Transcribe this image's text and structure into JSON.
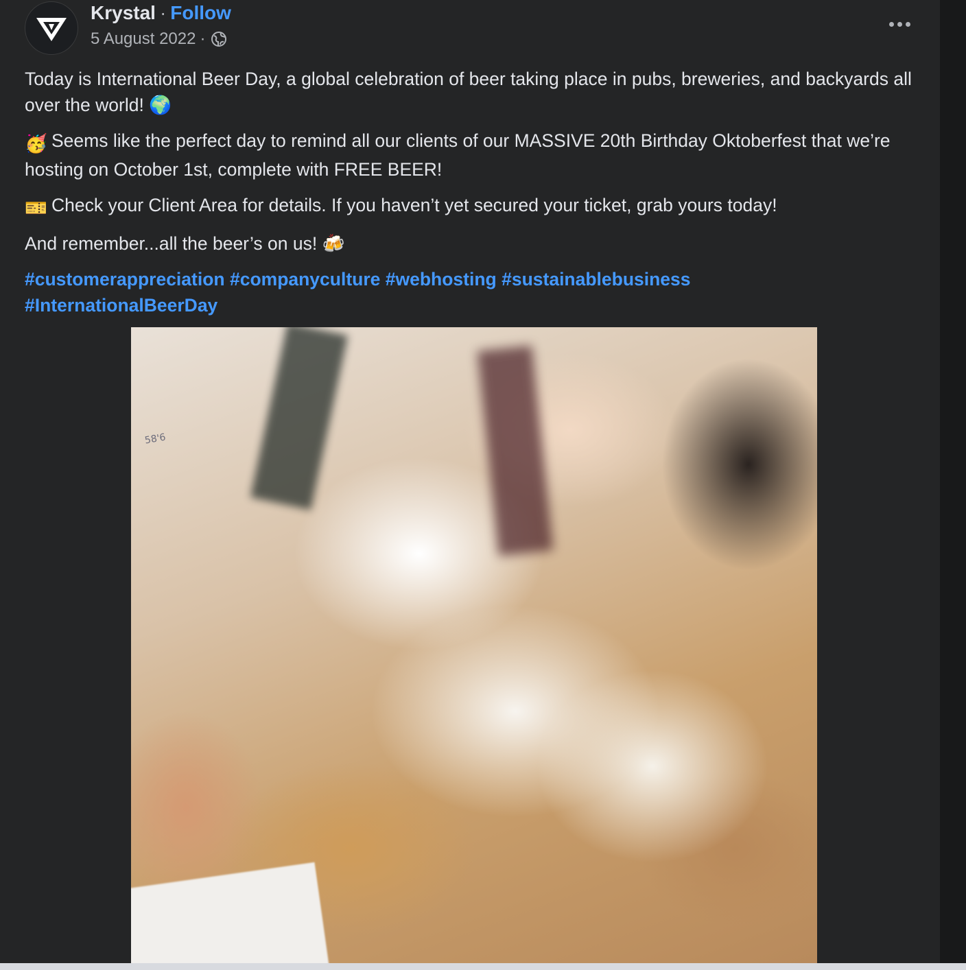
{
  "post": {
    "author": "Krystal",
    "separator": "·",
    "follow_label": "Follow",
    "date": "5 August 2022",
    "date_separator": "·",
    "privacy_icon": "globe-icon",
    "more_icon": "more-options-icon",
    "paragraphs": {
      "p1": "Today is International Beer Day, a global celebration of beer taking place in pubs, breweries, and backyards all over the world! 🌍",
      "p2": "Seems like the perfect day to remind all our clients of our MASSIVE 20th Birthday Oktoberfest that we’re hosting on October 1st, complete with FREE BEER!",
      "p3": "Check your Client Area for details. If you haven’t yet secured your ticket, grab yours today!",
      "p4": "And remember...all the beer’s on us! 🍻"
    },
    "emojis": {
      "p2": "🥳",
      "p3": "🎫"
    },
    "hashtags": {
      "h1": "#customerappreciation",
      "h2": "#companyculture",
      "h3": "#webhosting",
      "h4": "#sustainablebusiness",
      "h5": "#InternationalBeerDay"
    },
    "media": {
      "printed_text": "58'6"
    }
  },
  "colors": {
    "background": "#242526",
    "link": "#4599ff",
    "text": "#e4e6eb",
    "secondary_text": "#b0b3b8"
  }
}
